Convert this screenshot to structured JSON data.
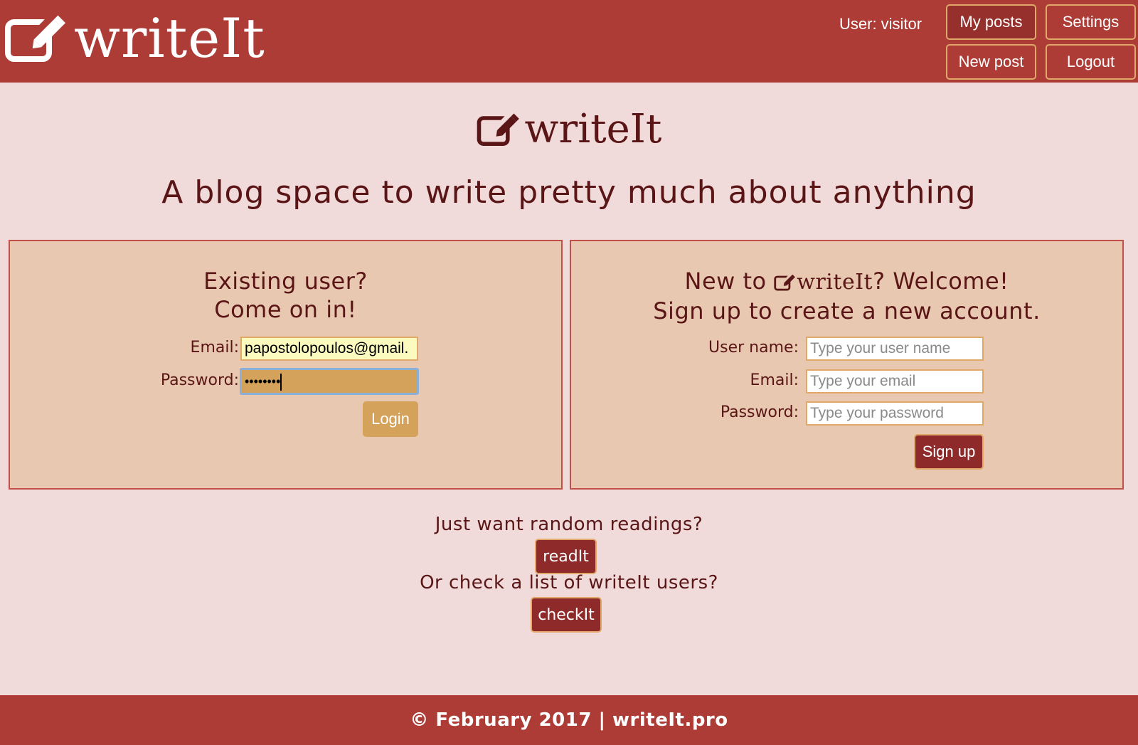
{
  "header": {
    "brand": "writeIt",
    "user_label": "User: visitor",
    "nav": {
      "my_posts": "My posts",
      "settings": "Settings",
      "new_post": "New post",
      "logout": "Logout"
    }
  },
  "hero": {
    "brand": "writeIt",
    "tagline": "A blog space to write pretty much about anything"
  },
  "login_panel": {
    "title_line1": "Existing user?",
    "title_line2": "Come on in!",
    "email_label": "Email:",
    "email_value": "papostolopoulos@gmail.",
    "password_label": "Password:",
    "password_value": "••••••••",
    "login_button": "Login"
  },
  "signup_panel": {
    "title_prefix": "New to ",
    "title_brand": "writeIt",
    "title_suffix": "? Welcome!",
    "title_line2": "Sign up to create a new account.",
    "username_label": "User name:",
    "username_placeholder": "Type your user name",
    "email_label": "Email:",
    "email_placeholder": "Type your email",
    "password_label": "Password:",
    "password_placeholder": "Type your password",
    "signup_button": "Sign up"
  },
  "discover": {
    "random_question": "Just want random readings?",
    "readit_button": "readIt",
    "users_question": "Or check a list of writeIt users?",
    "checkit_button": "checkIt"
  },
  "footer": {
    "text": "© February 2017 | writeIt.pro"
  },
  "icons": {
    "brand_icon": "edit-square-pencil-icon"
  },
  "colors": {
    "header_bg": "#ad3c37",
    "page_bg": "#f1dada",
    "panel_bg": "#e8c8b0",
    "text": "#5a1616",
    "accent": "#e0a96a",
    "login_button": "#d4a25a",
    "dark_button": "#8e2a2a"
  }
}
